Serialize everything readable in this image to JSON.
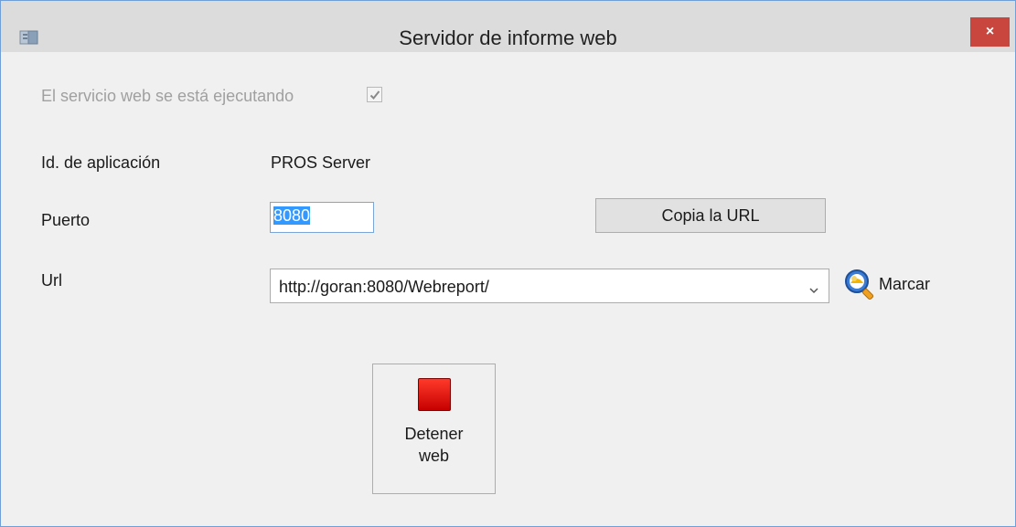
{
  "window": {
    "title": "Servidor de informe web",
    "close_label": "×",
    "icon": "app-window-icon"
  },
  "service": {
    "running_label": "El servicio web se está ejecutando",
    "running_checked": true
  },
  "app_id": {
    "label": "Id. de aplicación",
    "value": "PROS Server"
  },
  "port": {
    "label": "Puerto",
    "value": "8080"
  },
  "copy_url": {
    "label": "Copia la URL"
  },
  "url": {
    "label": "Url",
    "value": "http://goran:8080/Webreport/"
  },
  "marcar": {
    "label": "Marcar",
    "icon": "magnifier-icon"
  },
  "stop": {
    "line1": "Detener",
    "line2": "web",
    "icon": "stop-icon",
    "color": "#e00000"
  }
}
